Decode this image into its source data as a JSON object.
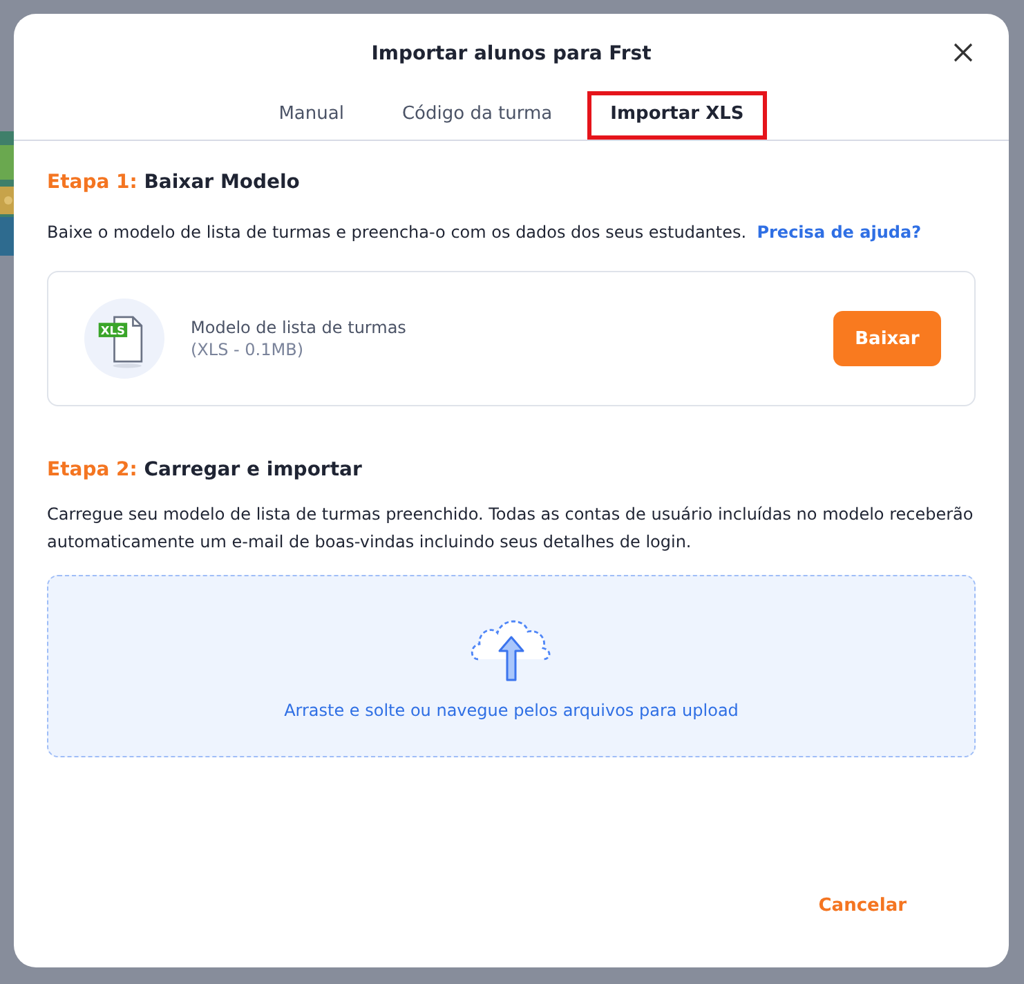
{
  "dialog": {
    "title": "Importar alunos para Frst"
  },
  "tabs": [
    {
      "label": "Manual",
      "selected": false,
      "highlighted": false
    },
    {
      "label": "Código da turma",
      "selected": false,
      "highlighted": false
    },
    {
      "label": "Importar XLS",
      "selected": true,
      "highlighted": true
    }
  ],
  "step1": {
    "prefix": "Etapa 1:",
    "title": "Baixar Modelo",
    "text": "Baixe o modelo de lista de turmas e preencha-o com os dados dos seus estudantes.",
    "help_link": "Precisa de ajuda?",
    "file": {
      "badge": "XLS",
      "name": "Modelo de lista de turmas",
      "details": "(XLS - 0.1MB)",
      "button": "Baixar"
    }
  },
  "step2": {
    "prefix": "Etapa 2:",
    "title": "Carregar e importar",
    "text": "Carregue seu modelo de lista de turmas preenchido. Todas as contas de usuário incluídas no modelo receberão automaticamente um e-mail de boas-vindas incluindo seus detalhes de login.",
    "dropzone": "Arraste e solte ou navegue pelos arquivos para upload"
  },
  "footer": {
    "cancel": "Cancelar"
  }
}
